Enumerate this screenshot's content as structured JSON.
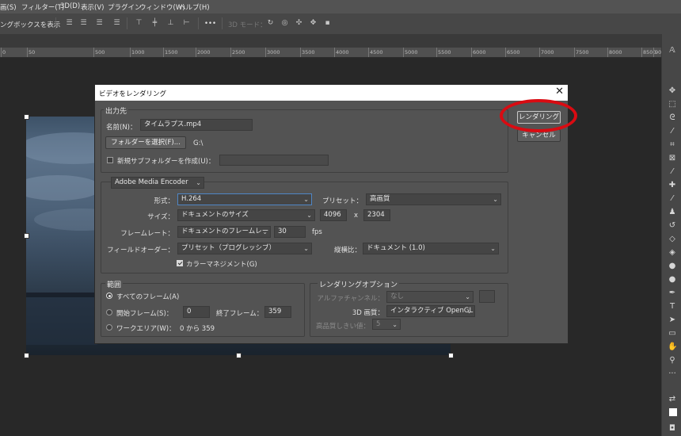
{
  "menu": [
    "画(S)",
    "フィルター(T)",
    "3D(D)",
    "表示(V)",
    "プラグイン",
    "ウィンドウ(W)",
    "ヘルプ(H)"
  ],
  "options_bar": {
    "show_transform": "ングボックスを表示",
    "more": "•••",
    "mode_3d": "3D モード："
  },
  "ruler": [
    "0",
    "50",
    "500",
    "1000",
    "1500",
    "2000",
    "2500",
    "3000",
    "3500",
    "4000",
    "4500",
    "5000",
    "5500",
    "6000",
    "6500",
    "7000",
    "7500",
    "8000",
    "8500",
    "9000"
  ],
  "dialog": {
    "title": "ビデオをレンダリング",
    "close": "✕",
    "render_button": "レンダリング",
    "cancel_button": "キャンセル",
    "output": {
      "group_title": "出力先",
      "name_label": "名前(N)：",
      "name_value": "タイムラプス.mp4",
      "select_folder": "フォルダーを選択(F)...",
      "folder_path": "G:\\",
      "new_subfolder": "新規サブフォルダーを作成(U)：",
      "subfolder_value": ""
    },
    "encoder": {
      "engine": "Adobe Media Encoder",
      "format_label": "形式：",
      "format_value": "H.264",
      "preset_label": "プリセット：",
      "preset_value": "高画質",
      "size_label": "サイズ：",
      "size_value": "ドキュメントのサイズ",
      "width": "4096",
      "x": "x",
      "height": "2304",
      "framerate_label": "フレームレート：",
      "framerate_value": "ドキュメントのフレームレート",
      "fps_value": "30",
      "fps_unit": "fps",
      "field_order_label": "フィールドオーダー：",
      "field_order_value": "プリセット（プログレッシブ）",
      "aspect_label": "縦横比：",
      "aspect_value": "ドキュメント (1.0)",
      "color_manage": "カラーマネジメント(G)",
      "color_manage_checked": true
    },
    "range": {
      "group_title": "範囲",
      "all_frames": "すべてのフレーム(A)",
      "start_frame_label": "開始フレーム(S)：",
      "start_frame": "0",
      "end_frame_label": "終了フレーム：",
      "end_frame": "359",
      "work_area": "ワークエリア(W)：",
      "work_area_value": "0 から 359",
      "selected": "all_frames"
    },
    "render_options": {
      "group_title": "レンダリングオプション",
      "alpha_label": "アルファチャンネル：",
      "alpha_value": "なし",
      "quality_label": "3D 画質：",
      "quality_value": "インタラクティブ OpenGL",
      "threshold_label": "高品質しきい値：",
      "threshold_value": "5"
    }
  },
  "colors": {
    "highlight": "#d90b12",
    "panel": "#535353",
    "canvas": "#282828"
  }
}
